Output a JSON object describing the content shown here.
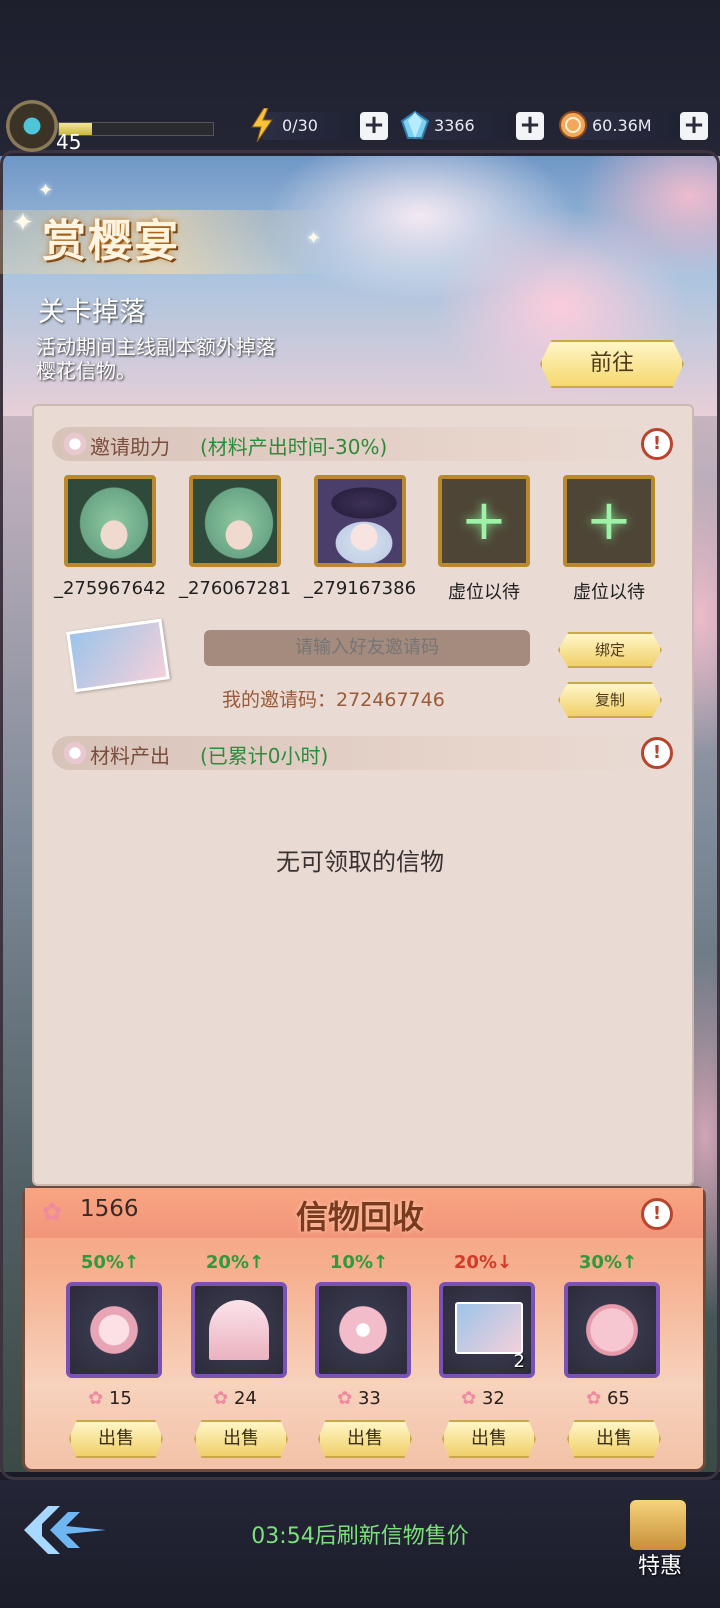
{
  "topbar": {
    "level": "45",
    "level_progress": 0.22,
    "energy": "0/30",
    "gems": "3366",
    "gold": "60.36M"
  },
  "event": {
    "title": "赏樱宴",
    "subtitle": "关卡掉落",
    "description": "活动期间主线副本额外掉落樱花信物。",
    "goto_label": "前往"
  },
  "invite": {
    "header": "邀请助力",
    "note": "(材料产出时间-30%)",
    "slots": [
      {
        "label": "_275967642",
        "type": "friend"
      },
      {
        "label": "_276067281",
        "type": "friend"
      },
      {
        "label": "_279167386",
        "type": "friend"
      },
      {
        "label": "虚位以待",
        "type": "empty"
      },
      {
        "label": "虚位以待",
        "type": "empty"
      }
    ],
    "input_placeholder": "请输入好友邀请码",
    "bind_label": "绑定",
    "copy_label": "复制",
    "my_code": "我的邀请码：272467746"
  },
  "materials": {
    "header": "材料产出",
    "note": "(已累计0小时)",
    "empty_text": "无可领取的信物"
  },
  "recycle": {
    "title": "信物回收",
    "currency": "1566",
    "items": [
      {
        "pct": "50%↑",
        "trend": "up",
        "price": "15",
        "qty": "",
        "sell": "出售"
      },
      {
        "pct": "20%↑",
        "trend": "up",
        "price": "24",
        "qty": "",
        "sell": "出售"
      },
      {
        "pct": "10%↑",
        "trend": "up",
        "price": "33",
        "qty": "",
        "sell": "出售"
      },
      {
        "pct": "20%↓",
        "trend": "down",
        "price": "32",
        "qty": "2",
        "sell": "出售"
      },
      {
        "pct": "30%↑",
        "trend": "up",
        "price": "65",
        "qty": "",
        "sell": "出售"
      }
    ]
  },
  "footer": {
    "refresh_text": "03:54后刷新信物售价",
    "special_label": "特惠"
  },
  "colors": {
    "up": "#2f9a3a",
    "down": "#d23a2a",
    "accent_gold": "#f1d06a"
  }
}
